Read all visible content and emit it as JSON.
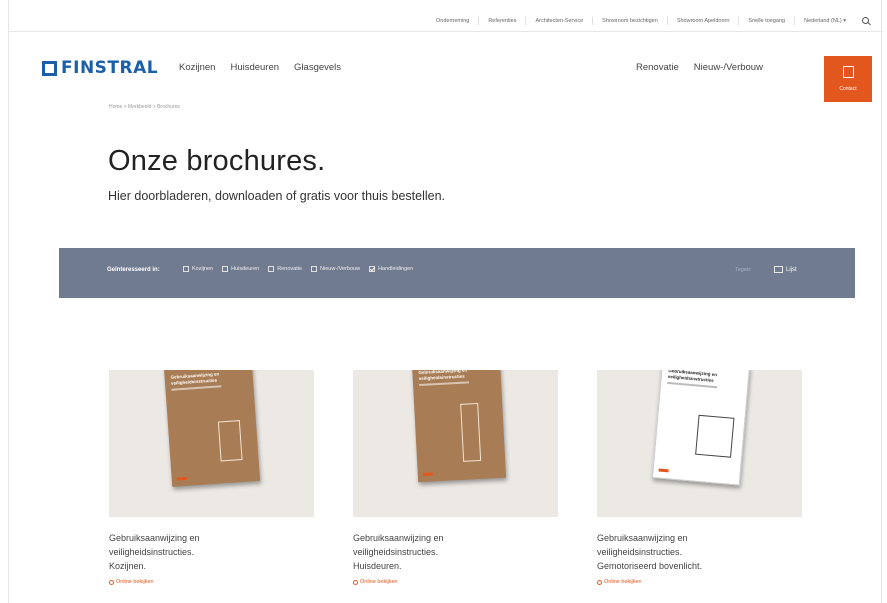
{
  "topbar": {
    "links": [
      "Onderneming",
      "Referenties",
      "Architecten-Service",
      "Showroom bezichtigen",
      "Showroom Apeldoorn",
      "Snelle toegang",
      "Nederland (NL) ▾"
    ]
  },
  "header": {
    "logo": "FINSTRAL",
    "nav": [
      "Kozijnen",
      "Huisdeuren",
      "Glasgevels"
    ],
    "right_nav": [
      "Renovatie",
      "Nieuw-/Verbouw"
    ],
    "contact_label": "Contact"
  },
  "breadcrumb": "Home > Merkbeeld > Brochures",
  "page": {
    "title": "Onze brochures.",
    "subtitle": "Hier doorbladeren, downloaden of gratis voor thuis bestellen."
  },
  "filter": {
    "label": "Geïnteresseerd in:",
    "options": [
      {
        "label": "Kozijnen",
        "checked": false
      },
      {
        "label": "Huisdeuren",
        "checked": false
      },
      {
        "label": "Renovatie",
        "checked": false
      },
      {
        "label": "Nieuw-/Verbouw",
        "checked": false
      },
      {
        "label": "Handleidingen",
        "checked": true
      }
    ],
    "view_tiles": "Tegels",
    "view_list": "Lijst"
  },
  "cards": [
    {
      "line1": "Gebruiksaanwijzing en",
      "line2": "veiligheidsinstructies.",
      "line3": "Kozijnen.",
      "link": "Online bekijken",
      "cover_title": "Gebruiksaanwijzing en veiligheidsinstructies",
      "cover_sub": "Kozijnen"
    },
    {
      "line1": "Gebruiksaanwijzing en",
      "line2": "veiligheidsinstructies.",
      "line3": "Huisdeuren.",
      "link": "Online bekijken",
      "cover_title": "Gebruiksaanwijzing en veiligheidsinstructies",
      "cover_sub": "Huisdeuren"
    },
    {
      "line1": "Gebruiksaanwijzing en",
      "line2": "veiligheidsinstructies.",
      "line3": "Gemotoriseerd bovenlicht.",
      "link": "Online bekijken",
      "cover_title": "Gebruiksaanwijzing en veiligheidsinstructies",
      "cover_sub": "Gemotoriseerd bovenlicht"
    }
  ],
  "colors": {
    "brand_blue": "#1a5fa8",
    "accent_orange": "#e2571e",
    "filter_bar": "#707b90"
  }
}
